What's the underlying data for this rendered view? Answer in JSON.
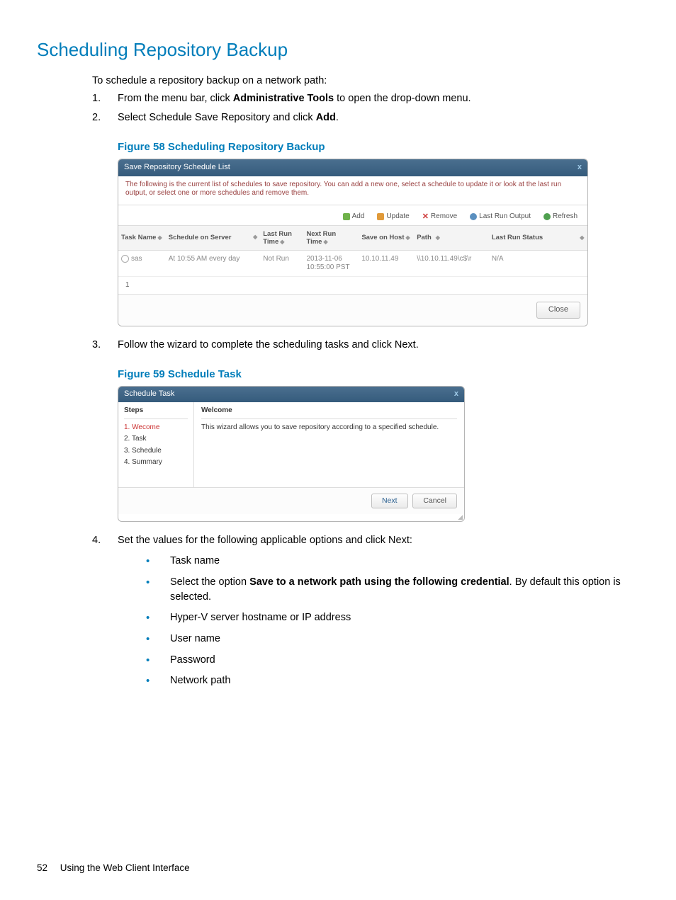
{
  "page": {
    "title": "Scheduling Repository Backup",
    "intro": "To schedule a repository backup on a network path:",
    "footer_num": "52",
    "footer_text": "Using the Web Client Interface"
  },
  "steps": {
    "s1_pre": "From the menu bar, click ",
    "s1_bold": "Administrative Tools",
    "s1_post": " to open the drop-down menu.",
    "s2_pre": "Select Schedule Save Repository and click ",
    "s2_bold": "Add",
    "s2_post": ".",
    "s3": "Follow the wizard to complete the scheduling tasks and click Next.",
    "s4": "Set the values for the following applicable options and click Next:"
  },
  "fig58": {
    "caption": "Figure 58  Scheduling Repository Backup",
    "title": "Save Repository Schedule List",
    "desc": "The following is the current list of schedules to save repository. You can add a new one, select a schedule to update it or look at the last run output, or select one or more schedules and remove them.",
    "toolbar": {
      "add": "Add",
      "update": "Update",
      "remove": "Remove",
      "last_run_output": "Last Run Output",
      "refresh": "Refresh"
    },
    "cols": {
      "task_name": "Task Name",
      "schedule_on_server": "Schedule on Server",
      "last_run_time": "Last Run Time",
      "next_run_time": "Next Run Time",
      "save_on_host": "Save on Host",
      "path": "Path",
      "last_run_status": "Last Run Status"
    },
    "row": {
      "task_name": "sas",
      "schedule": "At 10:55 AM every day",
      "last_run": "Not Run",
      "next_run": "2013-11-06 10:55:00 PST",
      "save_host": "10.10.11.49",
      "path": "\\\\10.10.11.49\\c$\\r",
      "status": "N/A"
    },
    "pager": "1",
    "close": "Close"
  },
  "fig59": {
    "caption": "Figure 59 Schedule Task",
    "title": "Schedule Task",
    "steps_header": "Steps",
    "step1": "1. Wecome",
    "step2": "2. Task",
    "step3": "3. Schedule",
    "step4": "4. Summary",
    "panel_header": "Welcome",
    "panel_body": "This wizard allows you to save repository according to a specified schedule.",
    "next": "Next",
    "cancel": "Cancel"
  },
  "bullets": {
    "b1": "Task name",
    "b2_pre": "Select the option ",
    "b2_bold": "Save to a network path using the following credential",
    "b2_post": ". By default this option is selected.",
    "b3": "Hyper-V server hostname or IP address",
    "b4": "User name",
    "b5": "Password",
    "b6": "Network path"
  }
}
